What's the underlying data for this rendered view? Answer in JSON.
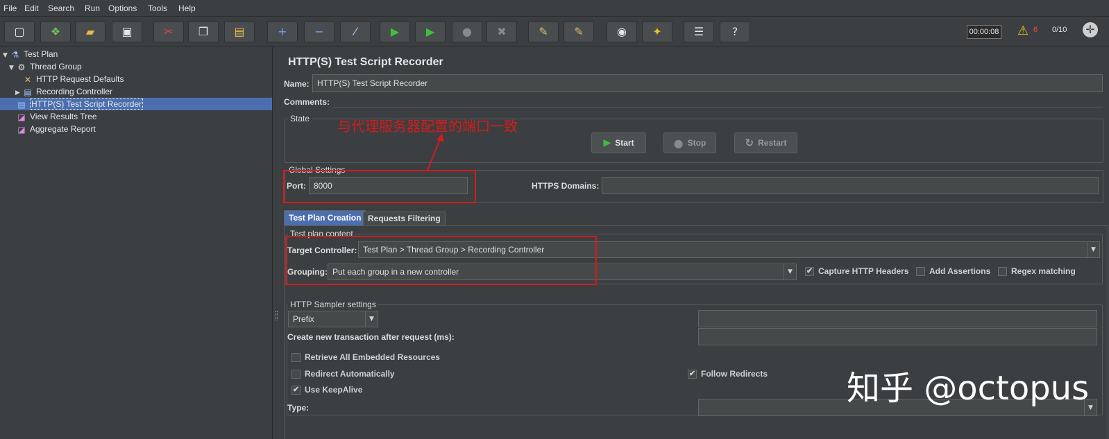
{
  "menu": [
    "File",
    "Edit",
    "Search",
    "Run",
    "Options",
    "Tools",
    "Help"
  ],
  "toolbar": {
    "buttons": [
      {
        "name": "new-icon",
        "glyph": "▢",
        "color": "#f2f2f2"
      },
      {
        "name": "templates-icon",
        "glyph": "❖",
        "color": "#6bbf59"
      },
      {
        "name": "open-icon",
        "glyph": "▰",
        "color": "#e8b84a"
      },
      {
        "name": "save-icon",
        "glyph": "▣",
        "color": "#e6e6e6"
      },
      {
        "name": "cut-icon",
        "glyph": "✂",
        "color": "#e04848"
      },
      {
        "name": "copy-icon",
        "glyph": "❐",
        "color": "#e6e6e6"
      },
      {
        "name": "paste-icon",
        "glyph": "▤",
        "color": "#e8b84a"
      },
      {
        "name": "expand-icon",
        "glyph": "+",
        "color": "#6aa2ff"
      },
      {
        "name": "collapse-icon",
        "glyph": "−",
        "color": "#6aa2ff"
      },
      {
        "name": "toggle-icon",
        "glyph": "⁄",
        "color": "#9ad0ff"
      },
      {
        "name": "start-icon",
        "glyph": "▶",
        "color": "#3fbf3f"
      },
      {
        "name": "start-no-pauses-icon",
        "glyph": "▶",
        "color": "#3fbf3f"
      },
      {
        "name": "stop-icon",
        "glyph": "●",
        "color": "#8a8a8a"
      },
      {
        "name": "shutdown-icon",
        "glyph": "✖",
        "color": "#8a8a8a"
      },
      {
        "name": "clear-icon",
        "glyph": "✎",
        "color": "#d8b86a"
      },
      {
        "name": "clear-all-icon",
        "glyph": "✎",
        "color": "#d8b86a"
      },
      {
        "name": "search-icon",
        "glyph": "◉",
        "color": "#e6e6e6"
      },
      {
        "name": "reset-search-icon",
        "glyph": "✦",
        "color": "#f0c419"
      },
      {
        "name": "function-helper-icon",
        "glyph": "☰",
        "color": "#e6e6e6"
      },
      {
        "name": "help-icon",
        "glyph": "?",
        "color": "#e6e6e6"
      }
    ],
    "timer": "00:00:08",
    "warnings": "6",
    "threads": "0/10"
  },
  "tree": [
    {
      "label": "Test Plan",
      "icon": "flask-icon",
      "glyph": "⚗",
      "level": 0,
      "expander": "▼",
      "selected": false
    },
    {
      "label": "Thread Group",
      "icon": "gear-icon",
      "glyph": "⚙",
      "level": 1,
      "expander": "▼",
      "selected": false
    },
    {
      "label": "HTTP Request Defaults",
      "icon": "wrench-icon",
      "glyph": "✕",
      "level": 2,
      "expander": "",
      "selected": false
    },
    {
      "label": "Recording Controller",
      "icon": "controller-icon",
      "glyph": "▤",
      "level": 2,
      "expander": "▶",
      "selected": false
    },
    {
      "label": "HTTP(S) Test Script Recorder",
      "icon": "recorder-icon",
      "glyph": "▤",
      "level": 1,
      "expander": "",
      "selected": true
    },
    {
      "label": "View Results Tree",
      "icon": "chart-icon",
      "glyph": "◪",
      "level": 1,
      "expander": "",
      "selected": false
    },
    {
      "label": "Aggregate Report",
      "icon": "chart-icon",
      "glyph": "◪",
      "level": 1,
      "expander": "",
      "selected": false
    }
  ],
  "panel": {
    "title": "HTTP(S) Test Script Recorder",
    "name_label": "Name:",
    "name_value": "HTTP(S) Test Script Recorder",
    "comments_label": "Comments:",
    "state_legend": "State",
    "annotation": "与代理服务器配置的端口一致",
    "start": "Start",
    "stop": "Stop",
    "restart": "Restart",
    "global_legend": "Global Settings",
    "port_label": "Port:",
    "port_value": "8000",
    "https_label": "HTTPS Domains:",
    "https_value": "",
    "tabs": [
      "Test Plan Creation",
      "Requests Filtering"
    ],
    "content_legend": "Test plan content",
    "target_label": "Target Controller:",
    "target_value": "Test Plan > Thread Group > Recording Controller",
    "grouping_label": "Grouping:",
    "grouping_value": "Put each group in a new controller",
    "capture_headers": "Capture HTTP Headers",
    "add_assertions": "Add Assertions",
    "regex_matching": "Regex matching",
    "sampler_legend": "HTTP Sampler settings",
    "prefix_value": "Prefix",
    "transaction_label": "Create new transaction after request (ms):",
    "retrieve_embedded": "Retrieve All Embedded Resources",
    "redirect_auto": "Redirect Automatically",
    "follow_redirects": "Follow Redirects",
    "use_keepalive": "Use KeepAlive",
    "type_label": "Type:"
  },
  "watermark": "知乎 @octopus",
  "colors": {
    "accent": "#4b6eaf",
    "annotation": "#d21c1c",
    "warning": "#f0c419"
  }
}
